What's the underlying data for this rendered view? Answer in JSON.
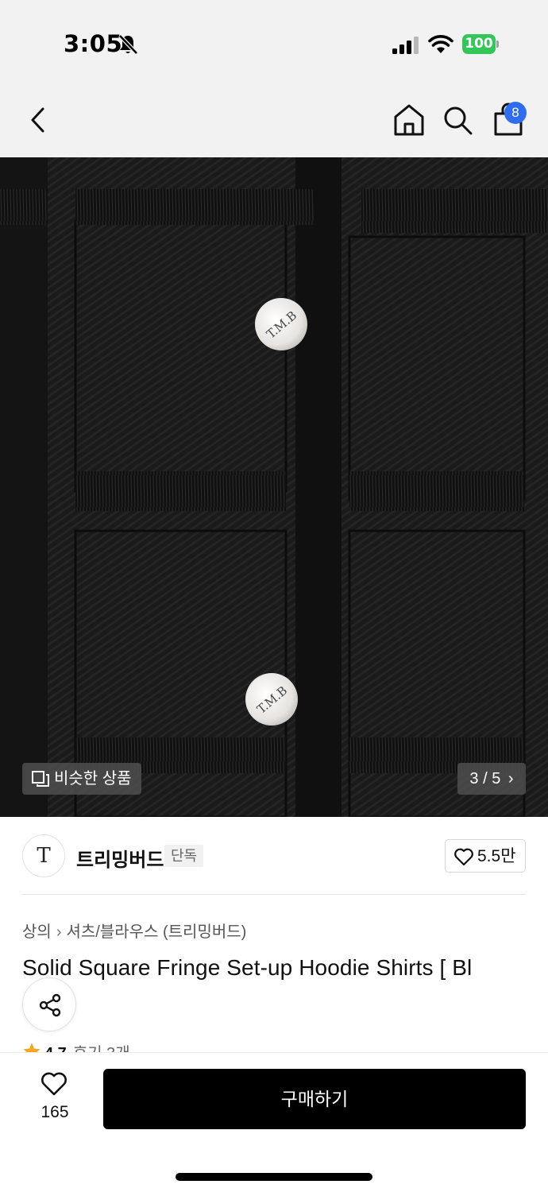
{
  "status_bar": {
    "time": "3:05",
    "battery": "100"
  },
  "nav": {
    "cart_count": "8"
  },
  "image": {
    "similar_label": "비슷한 상품",
    "page_indicator": "3 / 5",
    "button_engraving": "T.M.B"
  },
  "brand": {
    "logo_text": "T",
    "name": "트리밍버드",
    "badge": "단독",
    "like_count": "5.5만"
  },
  "breadcrumb": [
    "상의",
    "셔츠/블라우스 (트리밍버드)"
  ],
  "product": {
    "title": "Solid Square Fringe Set-up Hoodie Shirts [ Bl",
    "rating": "4.7",
    "review_label": "후기 3개"
  },
  "bottom": {
    "wish_count": "165",
    "buy_label": "구매하기"
  },
  "colors": {
    "accent_badge": "#2f6cf0",
    "battery": "#33c759",
    "star": "#f5a623"
  }
}
